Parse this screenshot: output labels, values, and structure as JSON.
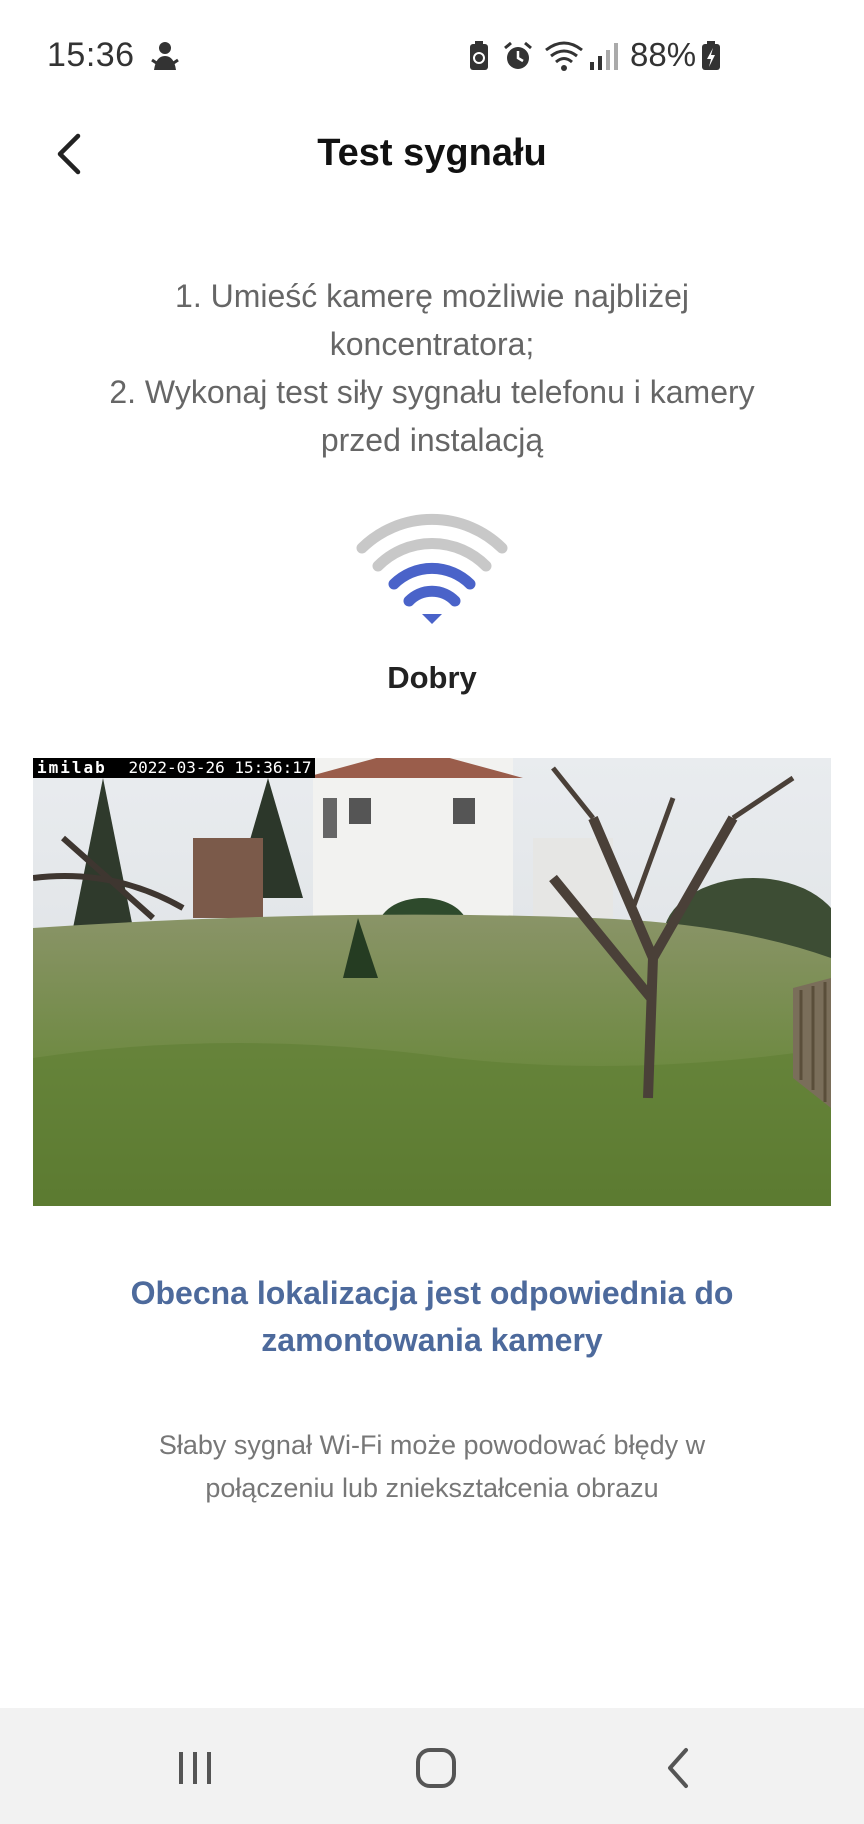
{
  "status_bar": {
    "time": "15:36",
    "battery_percent": "88%",
    "icons": [
      "notification-icon",
      "battery-saver-icon",
      "alarm-icon",
      "wifi-icon",
      "signal-icon",
      "battery-charging-icon"
    ]
  },
  "header": {
    "title": "Test sygnału",
    "back_icon": "chevron-left-icon"
  },
  "instructions": {
    "line1": "1. Umieść kamerę możliwie najbliżej koncentratora;",
    "line2": "2. Wykonaj test siły sygnału telefonu i kamery przed instalacją"
  },
  "signal": {
    "icon": "wifi-signal-icon",
    "label": "Dobry",
    "bars_total": 4,
    "bars_active": 2,
    "active_color": "#4a63c9",
    "inactive_color": "#c8c8c8"
  },
  "camera": {
    "brand": "imilab",
    "timestamp": "2022-03-26 15:36:17"
  },
  "result": {
    "title": "Obecna lokalizacja jest odpowiednia do zamontowania kamery",
    "note": "Słaby sygnał Wi-Fi może powodować błędy w połączeniu lub zniekształcenia obrazu",
    "title_color": "#4d6a9c"
  },
  "nav_bar": {
    "recents_icon": "recents-icon",
    "home_icon": "home-icon",
    "back_icon": "back-icon"
  }
}
